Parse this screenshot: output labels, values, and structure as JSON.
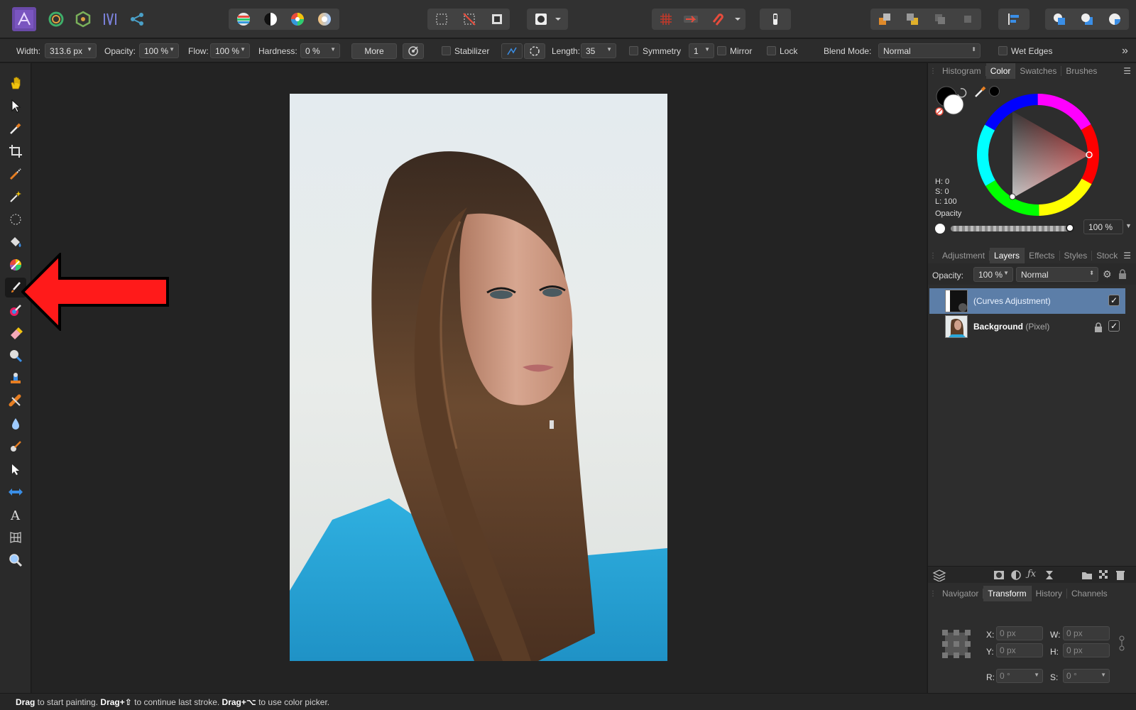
{
  "context": {
    "width_label": "Width:",
    "width_value": "313.6 px",
    "opacity_label": "Opacity:",
    "opacity_value": "100 %",
    "flow_label": "Flow:",
    "flow_value": "100 %",
    "hardness_label": "Hardness:",
    "hardness_value": "0 %",
    "more_label": "More",
    "stabilizer_label": "Stabilizer",
    "length_label": "Length:",
    "length_value": "35",
    "symmetry_label": "Symmetry",
    "symmetry_value": "1",
    "mirror_label": "Mirror",
    "lock_label": "Lock",
    "blend_label": "Blend Mode:",
    "blend_value": "Normal",
    "wet_edges_label": "Wet Edges",
    "overflow_label": "»"
  },
  "color_panel": {
    "tabs": [
      "Histogram",
      "Color",
      "Swatches",
      "Brushes"
    ],
    "active_tab": "Color",
    "h": "H: 0",
    "s": "S: 0",
    "l": "L: 100",
    "opacity_label": "Opacity",
    "opacity_value": "100 %"
  },
  "layers_panel": {
    "tabs": [
      "Adjustment",
      "Layers",
      "Effects",
      "Styles",
      "Stock"
    ],
    "active_tab": "Layers",
    "opacity_label": "Opacity:",
    "opacity_value": "100 %",
    "blend_value": "Normal",
    "layers": [
      {
        "name": "(Curves Adjustment)",
        "type": "",
        "selected": true
      },
      {
        "name": "Background",
        "type": "(Pixel)",
        "selected": false
      }
    ]
  },
  "transform_panel": {
    "tabs": [
      "Navigator",
      "Transform",
      "History",
      "Channels"
    ],
    "active_tab": "Transform",
    "x_label": "X:",
    "x_value": "0 px",
    "y_label": "Y:",
    "y_value": "0 px",
    "w_label": "W:",
    "w_value": "0 px",
    "h_label": "H:",
    "h_value": "0 px",
    "r_label": "R:",
    "r_value": "0 °",
    "s_label": "S:",
    "s_value": "0 °"
  },
  "status": {
    "drag1": "Drag",
    "text1": " to start painting. ",
    "drag2": "Drag+⇧",
    "text2": " to continue last stroke. ",
    "drag3": "Drag+⌥",
    "text3": " to use color picker."
  },
  "colors": {
    "accent": "#5c7ea8",
    "annotation_arrow": "#ff1a1a",
    "shirt": "#2aa6d8"
  }
}
